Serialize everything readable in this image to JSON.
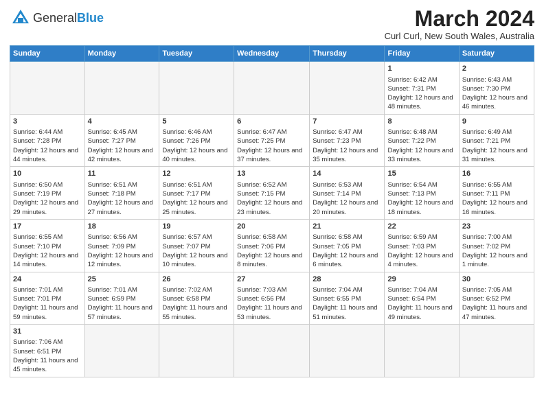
{
  "header": {
    "logo_general": "General",
    "logo_blue": "Blue",
    "month_title": "March 2024",
    "location": "Curl Curl, New South Wales, Australia"
  },
  "weekdays": [
    "Sunday",
    "Monday",
    "Tuesday",
    "Wednesday",
    "Thursday",
    "Friday",
    "Saturday"
  ],
  "weeks": [
    [
      {
        "day": "",
        "info": ""
      },
      {
        "day": "",
        "info": ""
      },
      {
        "day": "",
        "info": ""
      },
      {
        "day": "",
        "info": ""
      },
      {
        "day": "",
        "info": ""
      },
      {
        "day": "1",
        "info": "Sunrise: 6:42 AM\nSunset: 7:31 PM\nDaylight: 12 hours and 48 minutes."
      },
      {
        "day": "2",
        "info": "Sunrise: 6:43 AM\nSunset: 7:30 PM\nDaylight: 12 hours and 46 minutes."
      }
    ],
    [
      {
        "day": "3",
        "info": "Sunrise: 6:44 AM\nSunset: 7:28 PM\nDaylight: 12 hours and 44 minutes."
      },
      {
        "day": "4",
        "info": "Sunrise: 6:45 AM\nSunset: 7:27 PM\nDaylight: 12 hours and 42 minutes."
      },
      {
        "day": "5",
        "info": "Sunrise: 6:46 AM\nSunset: 7:26 PM\nDaylight: 12 hours and 40 minutes."
      },
      {
        "day": "6",
        "info": "Sunrise: 6:47 AM\nSunset: 7:25 PM\nDaylight: 12 hours and 37 minutes."
      },
      {
        "day": "7",
        "info": "Sunrise: 6:47 AM\nSunset: 7:23 PM\nDaylight: 12 hours and 35 minutes."
      },
      {
        "day": "8",
        "info": "Sunrise: 6:48 AM\nSunset: 7:22 PM\nDaylight: 12 hours and 33 minutes."
      },
      {
        "day": "9",
        "info": "Sunrise: 6:49 AM\nSunset: 7:21 PM\nDaylight: 12 hours and 31 minutes."
      }
    ],
    [
      {
        "day": "10",
        "info": "Sunrise: 6:50 AM\nSunset: 7:19 PM\nDaylight: 12 hours and 29 minutes."
      },
      {
        "day": "11",
        "info": "Sunrise: 6:51 AM\nSunset: 7:18 PM\nDaylight: 12 hours and 27 minutes."
      },
      {
        "day": "12",
        "info": "Sunrise: 6:51 AM\nSunset: 7:17 PM\nDaylight: 12 hours and 25 minutes."
      },
      {
        "day": "13",
        "info": "Sunrise: 6:52 AM\nSunset: 7:15 PM\nDaylight: 12 hours and 23 minutes."
      },
      {
        "day": "14",
        "info": "Sunrise: 6:53 AM\nSunset: 7:14 PM\nDaylight: 12 hours and 20 minutes."
      },
      {
        "day": "15",
        "info": "Sunrise: 6:54 AM\nSunset: 7:13 PM\nDaylight: 12 hours and 18 minutes."
      },
      {
        "day": "16",
        "info": "Sunrise: 6:55 AM\nSunset: 7:11 PM\nDaylight: 12 hours and 16 minutes."
      }
    ],
    [
      {
        "day": "17",
        "info": "Sunrise: 6:55 AM\nSunset: 7:10 PM\nDaylight: 12 hours and 14 minutes."
      },
      {
        "day": "18",
        "info": "Sunrise: 6:56 AM\nSunset: 7:09 PM\nDaylight: 12 hours and 12 minutes."
      },
      {
        "day": "19",
        "info": "Sunrise: 6:57 AM\nSunset: 7:07 PM\nDaylight: 12 hours and 10 minutes."
      },
      {
        "day": "20",
        "info": "Sunrise: 6:58 AM\nSunset: 7:06 PM\nDaylight: 12 hours and 8 minutes."
      },
      {
        "day": "21",
        "info": "Sunrise: 6:58 AM\nSunset: 7:05 PM\nDaylight: 12 hours and 6 minutes."
      },
      {
        "day": "22",
        "info": "Sunrise: 6:59 AM\nSunset: 7:03 PM\nDaylight: 12 hours and 4 minutes."
      },
      {
        "day": "23",
        "info": "Sunrise: 7:00 AM\nSunset: 7:02 PM\nDaylight: 12 hours and 1 minute."
      }
    ],
    [
      {
        "day": "24",
        "info": "Sunrise: 7:01 AM\nSunset: 7:01 PM\nDaylight: 11 hours and 59 minutes."
      },
      {
        "day": "25",
        "info": "Sunrise: 7:01 AM\nSunset: 6:59 PM\nDaylight: 11 hours and 57 minutes."
      },
      {
        "day": "26",
        "info": "Sunrise: 7:02 AM\nSunset: 6:58 PM\nDaylight: 11 hours and 55 minutes."
      },
      {
        "day": "27",
        "info": "Sunrise: 7:03 AM\nSunset: 6:56 PM\nDaylight: 11 hours and 53 minutes."
      },
      {
        "day": "28",
        "info": "Sunrise: 7:04 AM\nSunset: 6:55 PM\nDaylight: 11 hours and 51 minutes."
      },
      {
        "day": "29",
        "info": "Sunrise: 7:04 AM\nSunset: 6:54 PM\nDaylight: 11 hours and 49 minutes."
      },
      {
        "day": "30",
        "info": "Sunrise: 7:05 AM\nSunset: 6:52 PM\nDaylight: 11 hours and 47 minutes."
      }
    ],
    [
      {
        "day": "31",
        "info": "Sunrise: 7:06 AM\nSunset: 6:51 PM\nDaylight: 11 hours and 45 minutes."
      },
      {
        "day": "",
        "info": ""
      },
      {
        "day": "",
        "info": ""
      },
      {
        "day": "",
        "info": ""
      },
      {
        "day": "",
        "info": ""
      },
      {
        "day": "",
        "info": ""
      },
      {
        "day": "",
        "info": ""
      }
    ]
  ]
}
